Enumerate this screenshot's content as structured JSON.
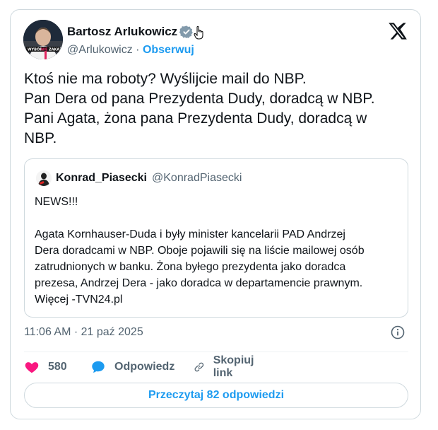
{
  "author": {
    "name": "Bartosz Arlukowicz",
    "handle": "@Arlukowicz",
    "separator": "·",
    "follow_label": "Obserwuj",
    "avatar_badge": "WYBÓR NIE ZAKAZ"
  },
  "tweet": {
    "lines": [
      "Ktoś nie ma roboty? Wyślijcie mail do NBP.",
      "Pan Dera od pana Prezydenta Dudy, doradcą w NBP.",
      "Pani Agata, żona pana Prezydenta Dudy, doradcą w",
      "NBP."
    ]
  },
  "quote": {
    "name": "Konrad_Piasecki",
    "handle": "@KonradPiasecki",
    "lines": [
      "NEWS!!!",
      "",
      "Agata Kornhauser-Duda i były minister kancelarii PAD Andrzej",
      "Dera doradcami w NBP. Oboje pojawili się na liście mailowej osób",
      "zatrudnionych w banku. Żona byłego prezydenta jako doradca",
      "prezesa, Andrzej Dera - jako doradca w departamencie prawnym.",
      "Więcej -TVN24.pl"
    ]
  },
  "meta": {
    "timestamp": "11:06 AM · 21 paź 2025"
  },
  "actions": {
    "likes": "580",
    "reply_label": "Odpowiedz",
    "copy_label": "Skopiuj link"
  },
  "read_replies_label": "Przeczytaj 82 odpowiedzi",
  "colors": {
    "accent": "#1d9bf0",
    "like": "#f91880",
    "text": "#0f1419",
    "secondary": "#536471",
    "border": "#cfd9de"
  }
}
